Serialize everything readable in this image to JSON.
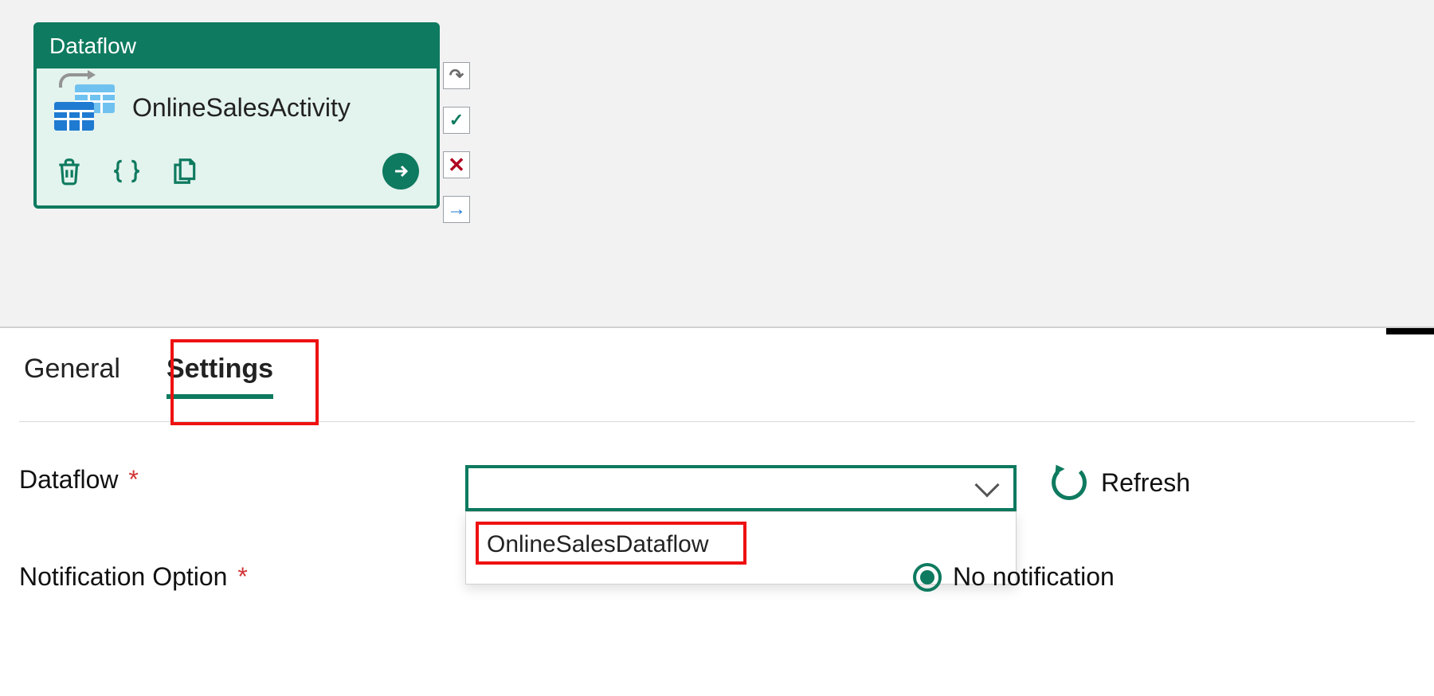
{
  "activity": {
    "type_label": "Dataflow",
    "name": "OnlineSalesActivity"
  },
  "side_handles": {
    "redo": "↷",
    "ok": "✓",
    "cancel": "✕",
    "next": "→"
  },
  "tabs": {
    "general": "General",
    "settings": "Settings"
  },
  "form": {
    "dataflow_label": "Dataflow",
    "notification_label": "Notification Option",
    "required_mark": "*",
    "dataflow_selected": "",
    "dataflow_options": [
      "OnlineSalesDataflow"
    ],
    "refresh_label": "Refresh",
    "notification_selected": "No notification"
  }
}
